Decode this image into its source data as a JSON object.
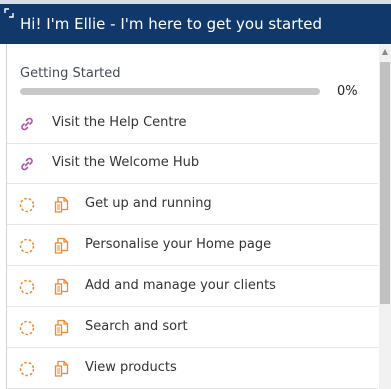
{
  "header": {
    "title": "Hi! I'm Ellie - I'm here to get you started"
  },
  "checklist": {
    "section_title": "Getting Started",
    "progress": 0,
    "progress_label": "0%",
    "items": [
      {
        "label": "Visit the Help Centre",
        "kind": "link"
      },
      {
        "label": "Visit the Welcome Hub",
        "kind": "link"
      },
      {
        "label": "Get up and running",
        "kind": "task"
      },
      {
        "label": "Personalise your Home page",
        "kind": "task"
      },
      {
        "label": "Add and manage your clients",
        "kind": "task"
      },
      {
        "label": "Search and sort",
        "kind": "task"
      },
      {
        "label": "View products",
        "kind": "task"
      }
    ]
  },
  "colors": {
    "header_bg": "#10386a",
    "link_icon": "#b14fb1",
    "task_icon": "#f0892d"
  }
}
